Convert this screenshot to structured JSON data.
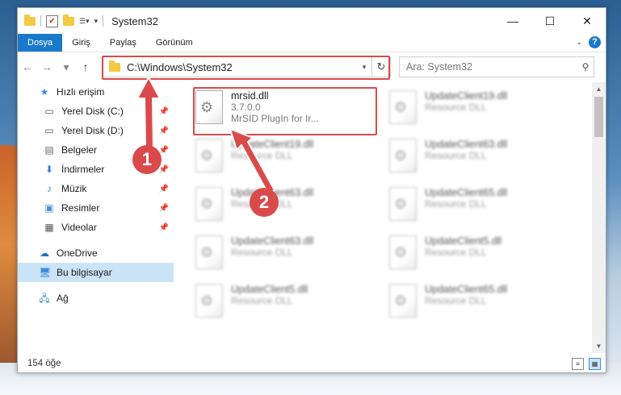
{
  "window": {
    "title": "System32",
    "minimize": "—",
    "maximize": "☐",
    "close": "✕"
  },
  "ribbon": {
    "tabs": [
      "Dosya",
      "Giriş",
      "Paylaş",
      "Görünüm"
    ]
  },
  "address": {
    "path": "C:\\Windows\\System32"
  },
  "search": {
    "placeholder": "Ara: System32"
  },
  "sidebar": {
    "items": [
      {
        "label": "Hızlı erişim"
      },
      {
        "label": "Yerel Disk (C:)"
      },
      {
        "label": "Yerel Disk (D:)"
      },
      {
        "label": "Belgeler"
      },
      {
        "label": "İndirmeler"
      },
      {
        "label": "Müzik"
      },
      {
        "label": "Resimler"
      },
      {
        "label": "Videolar"
      },
      {
        "label": "OneDrive"
      },
      {
        "label": "Bu bilgisayar"
      },
      {
        "label": "Ağ"
      }
    ]
  },
  "files": [
    {
      "name": "mrsid.dll",
      "version": "3.7.0.0",
      "desc": "MrSID PlugIn for Ir..."
    },
    {
      "name": "UpdateClient19.dll",
      "desc": "Resource DLL"
    },
    {
      "name": "UpdateClient19.dll",
      "desc": "Resource DLL"
    },
    {
      "name": "UpdateClient63.dll",
      "desc": "Resource DLL"
    },
    {
      "name": "UpdateClient63.dll",
      "desc": "Resource DLL"
    },
    {
      "name": "UpdateClient65.dll",
      "desc": "Resource DLL"
    },
    {
      "name": "UpdateClient63.dll",
      "desc": "Resource DLL"
    },
    {
      "name": "UpdateClient5.dll",
      "desc": "Resource DLL"
    },
    {
      "name": "UpdateClient5.dll",
      "desc": "Resource DLL"
    },
    {
      "name": "UpdateClient65.dll",
      "desc": "Resource DLL"
    }
  ],
  "status": {
    "count": "154 öğe"
  },
  "annotations": {
    "step1": "1",
    "step2": "2",
    "color": "#d94b4b"
  },
  "accent": "#1979ca"
}
